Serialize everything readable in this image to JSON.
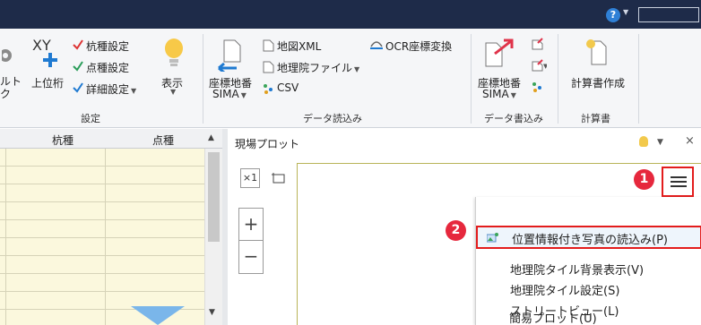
{
  "titlebar": {
    "help": "?"
  },
  "ribbon": {
    "settings": {
      "default_label": "ルト",
      "default_label2": "ク",
      "upper_digit": "上位桁",
      "stake_setting": "杭種設定",
      "point_setting": "点種設定",
      "detail_setting": "詳細設定",
      "display": "表示",
      "group": "設定"
    },
    "data_import": {
      "coord_sima_line1": "座標地番",
      "coord_sima_line2": "SIMA",
      "map_xml": "地図XML",
      "gsi_file": "地理院ファイル",
      "csv": "CSV",
      "ocr": "OCR座標変換",
      "group": "データ読込み"
    },
    "data_export": {
      "coord_sima_line1": "座標地番",
      "coord_sima_line2": "SIMA",
      "group": "データ書込み"
    },
    "calc": {
      "create": "計算書作成",
      "group": "計算書"
    }
  },
  "grid": {
    "col1": "杭種",
    "col2": "点種"
  },
  "panel": {
    "title": "現場プロット",
    "close": "×",
    "zoom_in": "+",
    "zoom_out": "−",
    "tool_fit": "×1"
  },
  "markers": {
    "one": "1",
    "two": "2"
  },
  "menu": {
    "items": [
      "位置情報付き写真の読込み(P)",
      "地理院タイル背景表示(V)",
      "地理院タイル設定(S)",
      "ストリートビュー(L)",
      "簡易プロット(U)"
    ]
  },
  "colors": {
    "titlebar": "#1e2b49",
    "accent_red": "#e31c1c",
    "marker_red": "#e6283d",
    "grid_fill": "#fbf8dd",
    "triangle": "#7ab6ea"
  }
}
